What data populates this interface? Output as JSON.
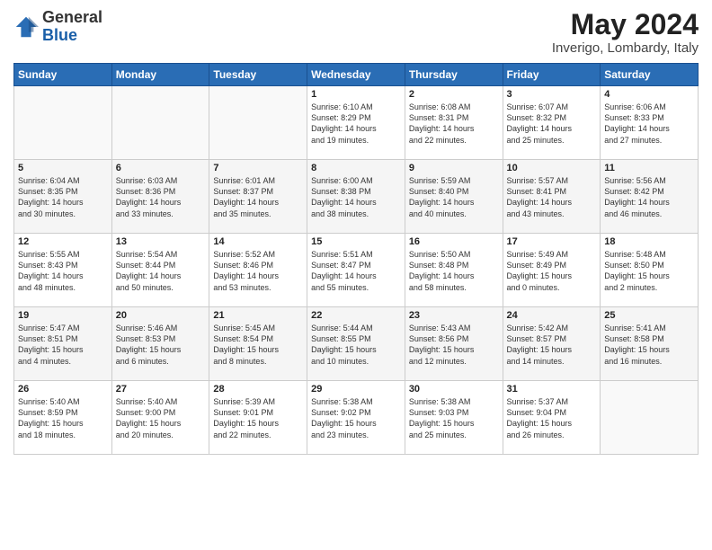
{
  "header": {
    "logo_line1": "General",
    "logo_line2": "Blue",
    "month_title": "May 2024",
    "location": "Inverigo, Lombardy, Italy"
  },
  "weekdays": [
    "Sunday",
    "Monday",
    "Tuesday",
    "Wednesday",
    "Thursday",
    "Friday",
    "Saturday"
  ],
  "weeks": [
    [
      {
        "day": "",
        "info": ""
      },
      {
        "day": "",
        "info": ""
      },
      {
        "day": "",
        "info": ""
      },
      {
        "day": "1",
        "info": "Sunrise: 6:10 AM\nSunset: 8:29 PM\nDaylight: 14 hours\nand 19 minutes."
      },
      {
        "day": "2",
        "info": "Sunrise: 6:08 AM\nSunset: 8:31 PM\nDaylight: 14 hours\nand 22 minutes."
      },
      {
        "day": "3",
        "info": "Sunrise: 6:07 AM\nSunset: 8:32 PM\nDaylight: 14 hours\nand 25 minutes."
      },
      {
        "day": "4",
        "info": "Sunrise: 6:06 AM\nSunset: 8:33 PM\nDaylight: 14 hours\nand 27 minutes."
      }
    ],
    [
      {
        "day": "5",
        "info": "Sunrise: 6:04 AM\nSunset: 8:35 PM\nDaylight: 14 hours\nand 30 minutes."
      },
      {
        "day": "6",
        "info": "Sunrise: 6:03 AM\nSunset: 8:36 PM\nDaylight: 14 hours\nand 33 minutes."
      },
      {
        "day": "7",
        "info": "Sunrise: 6:01 AM\nSunset: 8:37 PM\nDaylight: 14 hours\nand 35 minutes."
      },
      {
        "day": "8",
        "info": "Sunrise: 6:00 AM\nSunset: 8:38 PM\nDaylight: 14 hours\nand 38 minutes."
      },
      {
        "day": "9",
        "info": "Sunrise: 5:59 AM\nSunset: 8:40 PM\nDaylight: 14 hours\nand 40 minutes."
      },
      {
        "day": "10",
        "info": "Sunrise: 5:57 AM\nSunset: 8:41 PM\nDaylight: 14 hours\nand 43 minutes."
      },
      {
        "day": "11",
        "info": "Sunrise: 5:56 AM\nSunset: 8:42 PM\nDaylight: 14 hours\nand 46 minutes."
      }
    ],
    [
      {
        "day": "12",
        "info": "Sunrise: 5:55 AM\nSunset: 8:43 PM\nDaylight: 14 hours\nand 48 minutes."
      },
      {
        "day": "13",
        "info": "Sunrise: 5:54 AM\nSunset: 8:44 PM\nDaylight: 14 hours\nand 50 minutes."
      },
      {
        "day": "14",
        "info": "Sunrise: 5:52 AM\nSunset: 8:46 PM\nDaylight: 14 hours\nand 53 minutes."
      },
      {
        "day": "15",
        "info": "Sunrise: 5:51 AM\nSunset: 8:47 PM\nDaylight: 14 hours\nand 55 minutes."
      },
      {
        "day": "16",
        "info": "Sunrise: 5:50 AM\nSunset: 8:48 PM\nDaylight: 14 hours\nand 58 minutes."
      },
      {
        "day": "17",
        "info": "Sunrise: 5:49 AM\nSunset: 8:49 PM\nDaylight: 15 hours\nand 0 minutes."
      },
      {
        "day": "18",
        "info": "Sunrise: 5:48 AM\nSunset: 8:50 PM\nDaylight: 15 hours\nand 2 minutes."
      }
    ],
    [
      {
        "day": "19",
        "info": "Sunrise: 5:47 AM\nSunset: 8:51 PM\nDaylight: 15 hours\nand 4 minutes."
      },
      {
        "day": "20",
        "info": "Sunrise: 5:46 AM\nSunset: 8:53 PM\nDaylight: 15 hours\nand 6 minutes."
      },
      {
        "day": "21",
        "info": "Sunrise: 5:45 AM\nSunset: 8:54 PM\nDaylight: 15 hours\nand 8 minutes."
      },
      {
        "day": "22",
        "info": "Sunrise: 5:44 AM\nSunset: 8:55 PM\nDaylight: 15 hours\nand 10 minutes."
      },
      {
        "day": "23",
        "info": "Sunrise: 5:43 AM\nSunset: 8:56 PM\nDaylight: 15 hours\nand 12 minutes."
      },
      {
        "day": "24",
        "info": "Sunrise: 5:42 AM\nSunset: 8:57 PM\nDaylight: 15 hours\nand 14 minutes."
      },
      {
        "day": "25",
        "info": "Sunrise: 5:41 AM\nSunset: 8:58 PM\nDaylight: 15 hours\nand 16 minutes."
      }
    ],
    [
      {
        "day": "26",
        "info": "Sunrise: 5:40 AM\nSunset: 8:59 PM\nDaylight: 15 hours\nand 18 minutes."
      },
      {
        "day": "27",
        "info": "Sunrise: 5:40 AM\nSunset: 9:00 PM\nDaylight: 15 hours\nand 20 minutes."
      },
      {
        "day": "28",
        "info": "Sunrise: 5:39 AM\nSunset: 9:01 PM\nDaylight: 15 hours\nand 22 minutes."
      },
      {
        "day": "29",
        "info": "Sunrise: 5:38 AM\nSunset: 9:02 PM\nDaylight: 15 hours\nand 23 minutes."
      },
      {
        "day": "30",
        "info": "Sunrise: 5:38 AM\nSunset: 9:03 PM\nDaylight: 15 hours\nand 25 minutes."
      },
      {
        "day": "31",
        "info": "Sunrise: 5:37 AM\nSunset: 9:04 PM\nDaylight: 15 hours\nand 26 minutes."
      },
      {
        "day": "",
        "info": ""
      }
    ]
  ]
}
